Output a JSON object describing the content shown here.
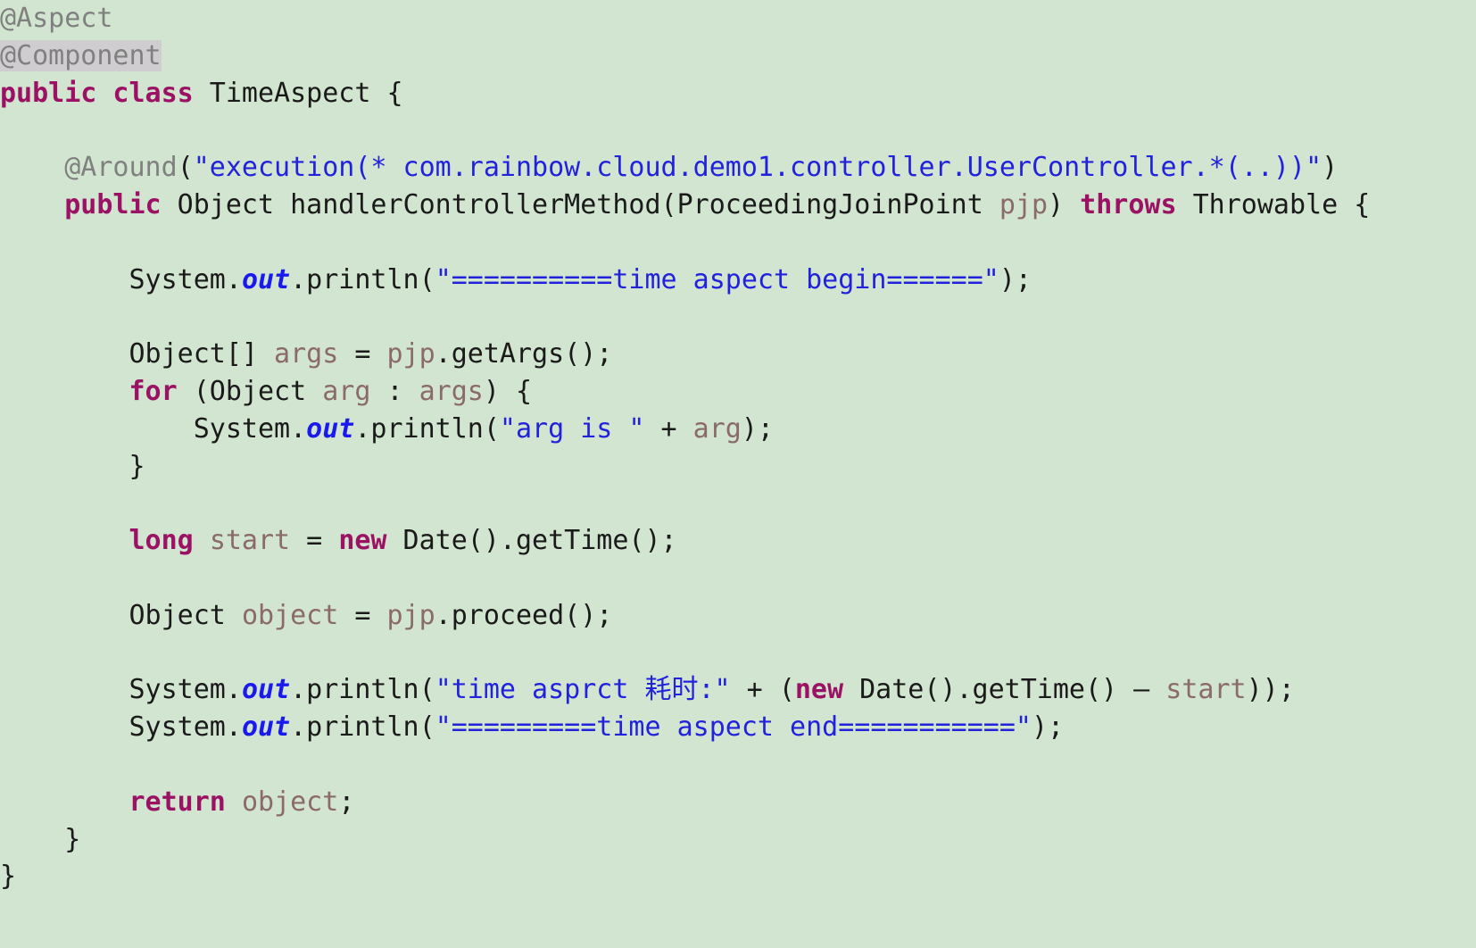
{
  "editor": {
    "language": "java",
    "background_color": "#d2e5d0",
    "colors": {
      "annotation": "#808080",
      "keyword": "#9b1264",
      "string": "#2222dd",
      "variable": "#8a6a6a",
      "static_field": "#1a1aee",
      "plain": "#1a1a1a",
      "selection": "#d0cdd0"
    },
    "lines": [
      {
        "n": 1,
        "tokens": [
          {
            "t": "@Aspect",
            "c": "anno"
          }
        ]
      },
      {
        "n": 2,
        "tokens": [
          {
            "t": "@Component",
            "c": "anno-sel"
          }
        ]
      },
      {
        "n": 3,
        "tokens": [
          {
            "t": "public class",
            "c": "kw"
          },
          {
            "t": " TimeAspect {",
            "c": "plain"
          }
        ]
      },
      {
        "n": 4,
        "tokens": []
      },
      {
        "n": 5,
        "tokens": [
          {
            "t": "    ",
            "c": "plain"
          },
          {
            "t": "@Around",
            "c": "anno"
          },
          {
            "t": "(",
            "c": "plain"
          },
          {
            "t": "\"execution(* com.rainbow.cloud.demo1.controller.UserController.*(..))\"",
            "c": "str"
          },
          {
            "t": ")",
            "c": "plain"
          }
        ]
      },
      {
        "n": 6,
        "tokens": [
          {
            "t": "    ",
            "c": "plain"
          },
          {
            "t": "public",
            "c": "kw"
          },
          {
            "t": " Object handlerControllerMethod(ProceedingJoinPoint ",
            "c": "plain"
          },
          {
            "t": "pjp",
            "c": "var"
          },
          {
            "t": ") ",
            "c": "plain"
          },
          {
            "t": "throws",
            "c": "kw"
          },
          {
            "t": " Throwable {",
            "c": "plain"
          }
        ]
      },
      {
        "n": 7,
        "tokens": []
      },
      {
        "n": 8,
        "tokens": [
          {
            "t": "        System.",
            "c": "plain"
          },
          {
            "t": "out",
            "c": "statfield"
          },
          {
            "t": ".println(",
            "c": "plain"
          },
          {
            "t": "\"==========time aspect begin======\"",
            "c": "str"
          },
          {
            "t": ");",
            "c": "plain"
          }
        ]
      },
      {
        "n": 9,
        "tokens": []
      },
      {
        "n": 10,
        "tokens": [
          {
            "t": "        Object[] ",
            "c": "plain"
          },
          {
            "t": "args",
            "c": "var"
          },
          {
            "t": " = ",
            "c": "plain"
          },
          {
            "t": "pjp",
            "c": "var"
          },
          {
            "t": ".getArgs();",
            "c": "plain"
          }
        ]
      },
      {
        "n": 11,
        "tokens": [
          {
            "t": "        ",
            "c": "plain"
          },
          {
            "t": "for",
            "c": "kw"
          },
          {
            "t": " (Object ",
            "c": "plain"
          },
          {
            "t": "arg",
            "c": "var"
          },
          {
            "t": " : ",
            "c": "plain"
          },
          {
            "t": "args",
            "c": "var"
          },
          {
            "t": ") {",
            "c": "plain"
          }
        ]
      },
      {
        "n": 12,
        "tokens": [
          {
            "t": "            System.",
            "c": "plain"
          },
          {
            "t": "out",
            "c": "statfield"
          },
          {
            "t": ".println(",
            "c": "plain"
          },
          {
            "t": "\"arg is \"",
            "c": "str"
          },
          {
            "t": " + ",
            "c": "plain"
          },
          {
            "t": "arg",
            "c": "var"
          },
          {
            "t": ");",
            "c": "plain"
          }
        ]
      },
      {
        "n": 13,
        "tokens": [
          {
            "t": "        }",
            "c": "plain"
          }
        ]
      },
      {
        "n": 14,
        "tokens": []
      },
      {
        "n": 15,
        "tokens": [
          {
            "t": "        ",
            "c": "plain"
          },
          {
            "t": "long",
            "c": "kw"
          },
          {
            "t": " ",
            "c": "plain"
          },
          {
            "t": "start",
            "c": "var"
          },
          {
            "t": " = ",
            "c": "plain"
          },
          {
            "t": "new",
            "c": "kw"
          },
          {
            "t": " Date().getTime();",
            "c": "plain"
          }
        ]
      },
      {
        "n": 16,
        "tokens": []
      },
      {
        "n": 17,
        "tokens": [
          {
            "t": "        Object ",
            "c": "plain"
          },
          {
            "t": "object",
            "c": "var"
          },
          {
            "t": " = ",
            "c": "plain"
          },
          {
            "t": "pjp",
            "c": "var"
          },
          {
            "t": ".proceed();",
            "c": "plain"
          }
        ]
      },
      {
        "n": 18,
        "tokens": []
      },
      {
        "n": 19,
        "tokens": [
          {
            "t": "        System.",
            "c": "plain"
          },
          {
            "t": "out",
            "c": "statfield"
          },
          {
            "t": ".println(",
            "c": "plain"
          },
          {
            "t": "\"time asprct 耗时:\"",
            "c": "str"
          },
          {
            "t": " + (",
            "c": "plain"
          },
          {
            "t": "new",
            "c": "kw"
          },
          {
            "t": " Date().getTime() – ",
            "c": "plain"
          },
          {
            "t": "start",
            "c": "var"
          },
          {
            "t": "));",
            "c": "plain"
          }
        ]
      },
      {
        "n": 20,
        "tokens": [
          {
            "t": "        System.",
            "c": "plain"
          },
          {
            "t": "out",
            "c": "statfield"
          },
          {
            "t": ".println(",
            "c": "plain"
          },
          {
            "t": "\"=========time aspect end===========\"",
            "c": "str"
          },
          {
            "t": ");",
            "c": "plain"
          }
        ]
      },
      {
        "n": 21,
        "tokens": []
      },
      {
        "n": 22,
        "tokens": [
          {
            "t": "        ",
            "c": "plain"
          },
          {
            "t": "return",
            "c": "kw"
          },
          {
            "t": " ",
            "c": "plain"
          },
          {
            "t": "object",
            "c": "var"
          },
          {
            "t": ";",
            "c": "plain"
          }
        ]
      },
      {
        "n": 23,
        "tokens": [
          {
            "t": "    }",
            "c": "plain"
          }
        ]
      },
      {
        "n": 24,
        "tokens": [
          {
            "t": "}",
            "c": "plain"
          }
        ]
      }
    ]
  }
}
